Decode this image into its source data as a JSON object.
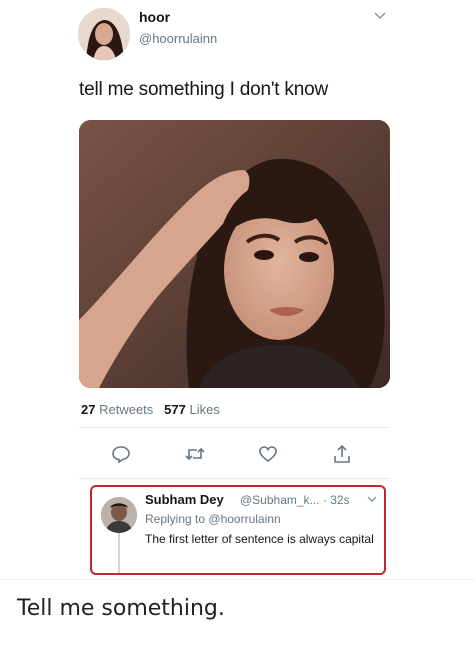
{
  "tweet": {
    "display_name": "hoor",
    "handle": "@hoorrulainn",
    "text": "tell me something I don't know",
    "stats": {
      "retweets_count": "27",
      "retweets_label": "Retweets",
      "likes_count": "577",
      "likes_label": "Likes"
    },
    "actions": [
      "reply-icon",
      "retweet-icon",
      "like-icon",
      "share-icon"
    ]
  },
  "reply": {
    "display_name": "Subham Dey",
    "handle_time": "@Subham_k... · 32s",
    "replying_prefix": "Replying to",
    "replying_to": "@hoorrulainn",
    "text": "The first letter of sentence is always capital",
    "highlight_color": "#c0272d"
  },
  "caption": "Tell me something.",
  "colors": {
    "secondary_text": "#657786",
    "primary_text": "#14171a",
    "divider": "#e6ecf0"
  }
}
